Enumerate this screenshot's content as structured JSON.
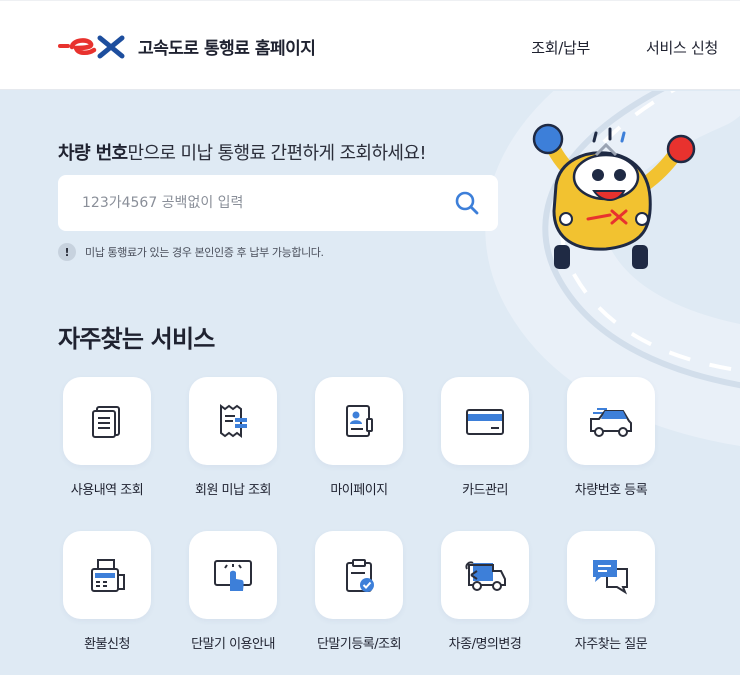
{
  "header": {
    "site_title": "고속도로 통행료 홈페이지",
    "nav": [
      "조회/납부",
      "서비스 신청"
    ]
  },
  "hero": {
    "headline_bold": "차량 번호",
    "headline_rest": "만으로 미납 통행료 간편하게 조회하세요!",
    "search": {
      "placeholder": "123가4567 공백없이 입력"
    },
    "notice": "미납 통행료가 있는 경우 본인인증 후 납부 가능합니다."
  },
  "services": {
    "title": "자주찾는 서비스",
    "items": [
      {
        "label": "사용내역 조회",
        "icon": "document-list-icon"
      },
      {
        "label": "회원 미납 조회",
        "icon": "receipt-icon"
      },
      {
        "label": "마이페이지",
        "icon": "profile-card-icon"
      },
      {
        "label": "카드관리",
        "icon": "credit-card-icon"
      },
      {
        "label": "차량번호 등록",
        "icon": "truck-icon"
      },
      {
        "label": "환불신청",
        "icon": "fax-machine-icon"
      },
      {
        "label": "단말기 이용안내",
        "icon": "touch-screen-icon"
      },
      {
        "label": "단말기등록/조회",
        "icon": "clipboard-check-icon"
      },
      {
        "label": "차종/명의변경",
        "icon": "truck-transfer-icon"
      },
      {
        "label": "자주찾는 질문",
        "icon": "chat-bubbles-icon"
      }
    ]
  },
  "colors": {
    "accent_blue": "#3d7fd9",
    "logo_red": "#e8322e",
    "logo_blue": "#1d4e9e",
    "background": "#dfeaf4"
  }
}
